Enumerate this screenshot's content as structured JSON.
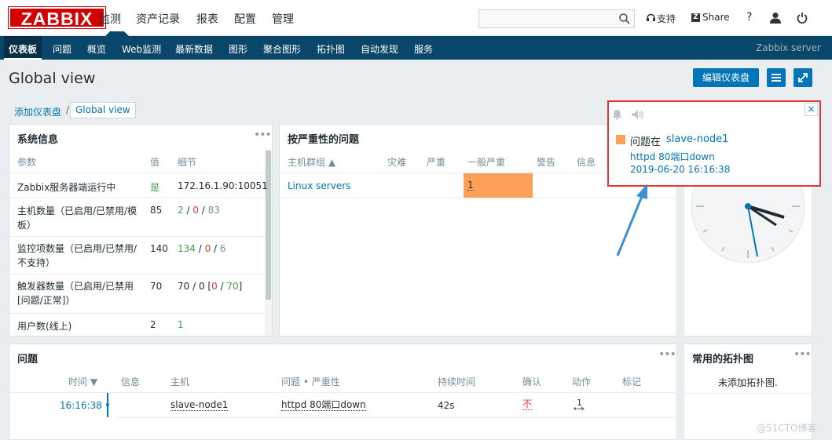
{
  "brand": {
    "logo": "ZABBIX"
  },
  "mainnav": [
    "监测",
    "资产记录",
    "报表",
    "配置",
    "管理"
  ],
  "header_tools": {
    "support": "支持",
    "share": "Share",
    "help": "?"
  },
  "subnav": {
    "items": [
      "仪表板",
      "问题",
      "概览",
      "Web监测",
      "最新数据",
      "图形",
      "聚合图形",
      "拓扑图",
      "自动发现",
      "服务"
    ],
    "server": "Zabbix server"
  },
  "page": {
    "title": "Global view",
    "edit_button": "编辑仪表盘"
  },
  "breadcrumb": {
    "parent": "添加仪表盘",
    "sep": "/",
    "current": "Global view"
  },
  "sysinfo": {
    "title": "系统信息",
    "dots": "•••",
    "headers": [
      "参数",
      "值",
      "细节"
    ],
    "rows": [
      {
        "param": "Zabbix服务器端运行中",
        "value": "是",
        "detail": "172.16.1.90:10051"
      },
      {
        "param": "主机数量（已启用/已禁用/模板）",
        "value": "85",
        "d1": "2",
        "s1": " / ",
        "d2": "0",
        "s2": " / ",
        "d3": "83"
      },
      {
        "param": "监控项数量（已启用/已禁用/不支持）",
        "value": "140",
        "d1": "134",
        "s1": " / ",
        "d2": "0",
        "s2": " / ",
        "d3": "6"
      },
      {
        "param": "触发器数量（已启用/已禁用[问题/正常]）",
        "value": "70",
        "d0": "70 / 0 [",
        "d2": "0",
        "s2": " / ",
        "d3": "70",
        "d4": "]"
      },
      {
        "param": "用户数(线上)",
        "value": "2",
        "detail": "1"
      }
    ]
  },
  "severity": {
    "title": "按严重性的问题",
    "dots": "•••",
    "headers": [
      "主机群组 ▲",
      "灾难",
      "严重",
      "一般严重",
      "警告",
      "信息"
    ],
    "row": {
      "group": "Linux servers",
      "average": "1"
    }
  },
  "problems": {
    "title": "问题",
    "dots": "•••",
    "headers": [
      "时间 ▼",
      "信息",
      "主机",
      "问题 • 严重性",
      "持续时间",
      "确认",
      "动作",
      "标记"
    ],
    "row": {
      "time": "16:16:38",
      "host": "slave-node1",
      "problem": "httpd 80端口down",
      "duration": "42s",
      "ack": "不",
      "actions": "1"
    }
  },
  "maps": {
    "title": "常用的拓扑图",
    "dots": "•••",
    "empty": "未添加拓扑图."
  },
  "clock": {
    "dots": "•••"
  },
  "popup": {
    "close": "×",
    "prefix": "问题在",
    "host": "slave-node1",
    "message": "httpd 80端口down",
    "datetime": "2019-06-20 16:16:38"
  },
  "watermark": "@51CTO博客",
  "colors": {
    "brand_red": "#d40000",
    "nav_blue": "#0a466a",
    "link": "#0275b8",
    "average": "#ffa059",
    "highlight": "#e03636"
  }
}
